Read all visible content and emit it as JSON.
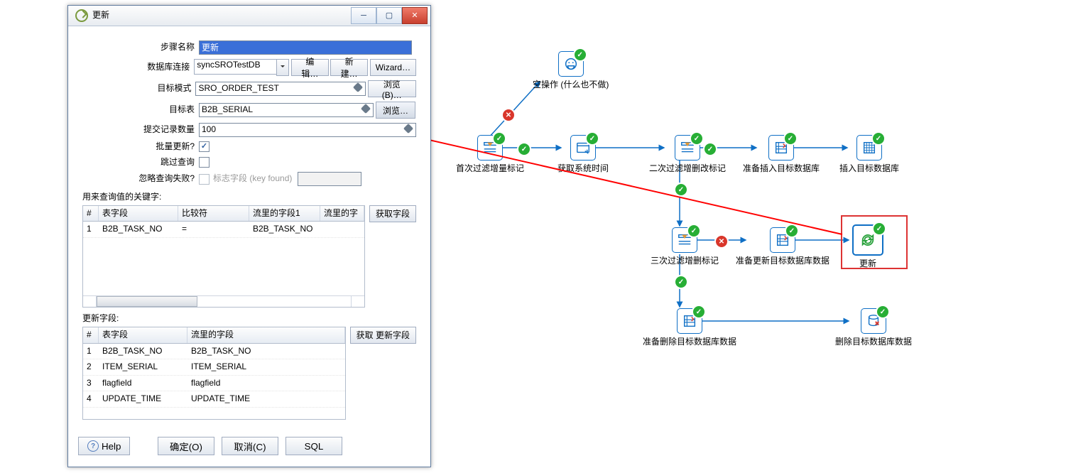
{
  "dialog": {
    "title": "更新",
    "labels": {
      "step": "步骤名称",
      "conn": "数据库连接",
      "schema": "目标模式",
      "table": "目标表",
      "commit": "提交记录数量",
      "batch": "批量更新?",
      "skip": "跳过查询",
      "ignore": "忽略查询失败?",
      "keyhint": "标志字段 (key found)"
    },
    "step_value": "更新",
    "conn_value": "syncSROTestDB",
    "schema_value": "SRO_ORDER_TEST",
    "table_value": "B2B_SERIAL",
    "commit_value": "100",
    "btns": {
      "edit": "编辑…",
      "new": "新建…",
      "wizard": "Wizard…",
      "browseB": "浏览(B)…",
      "browse": "浏览…",
      "getField": "获取字段",
      "getUpd": "获取 更新字段"
    },
    "sec1": "用来查询值的关键字:",
    "sec2": "更新字段:",
    "kcols": {
      "n": "#",
      "tf": "表字段",
      "cmp": "比较符",
      "sf1": "流里的字段1",
      "sf2": "流里的字"
    },
    "krows": [
      {
        "n": "1",
        "tf": "B2B_TASK_NO",
        "cmp": "=",
        "sf1": "B2B_TASK_NO"
      }
    ],
    "ucols": {
      "n": "#",
      "tf": "表字段",
      "sf": "流里的字段"
    },
    "urows": [
      {
        "n": "1",
        "tf": "B2B_TASK_NO",
        "sf": "B2B_TASK_NO"
      },
      {
        "n": "2",
        "tf": "ITEM_SERIAL",
        "sf": "ITEM_SERIAL"
      },
      {
        "n": "3",
        "tf": "flagfield",
        "sf": "flagfield"
      },
      {
        "n": "4",
        "tf": "UPDATE_TIME",
        "sf": "UPDATE_TIME"
      }
    ],
    "bottom": {
      "help": "Help",
      "ok": "确定(O)",
      "cancel": "取消(C)",
      "sql": "SQL"
    }
  },
  "nodes": {
    "noop": "空操作 (什么也不做)",
    "filter1": "首次过滤增量标记",
    "gettime": "获取系统时间",
    "filter2": "二次过滤增删改标记",
    "prepins": "准备插入目标数据库",
    "ins": "插入目标数据库",
    "filter3": "三次过滤增删标记",
    "prepupd": "准备更新目标数据库数据",
    "upd": "更新",
    "prepdel": "准备删除目标数据库数据",
    "del": "删除目标数据库数据"
  },
  "icons": {
    "check": "✓",
    "cross": "✕"
  }
}
